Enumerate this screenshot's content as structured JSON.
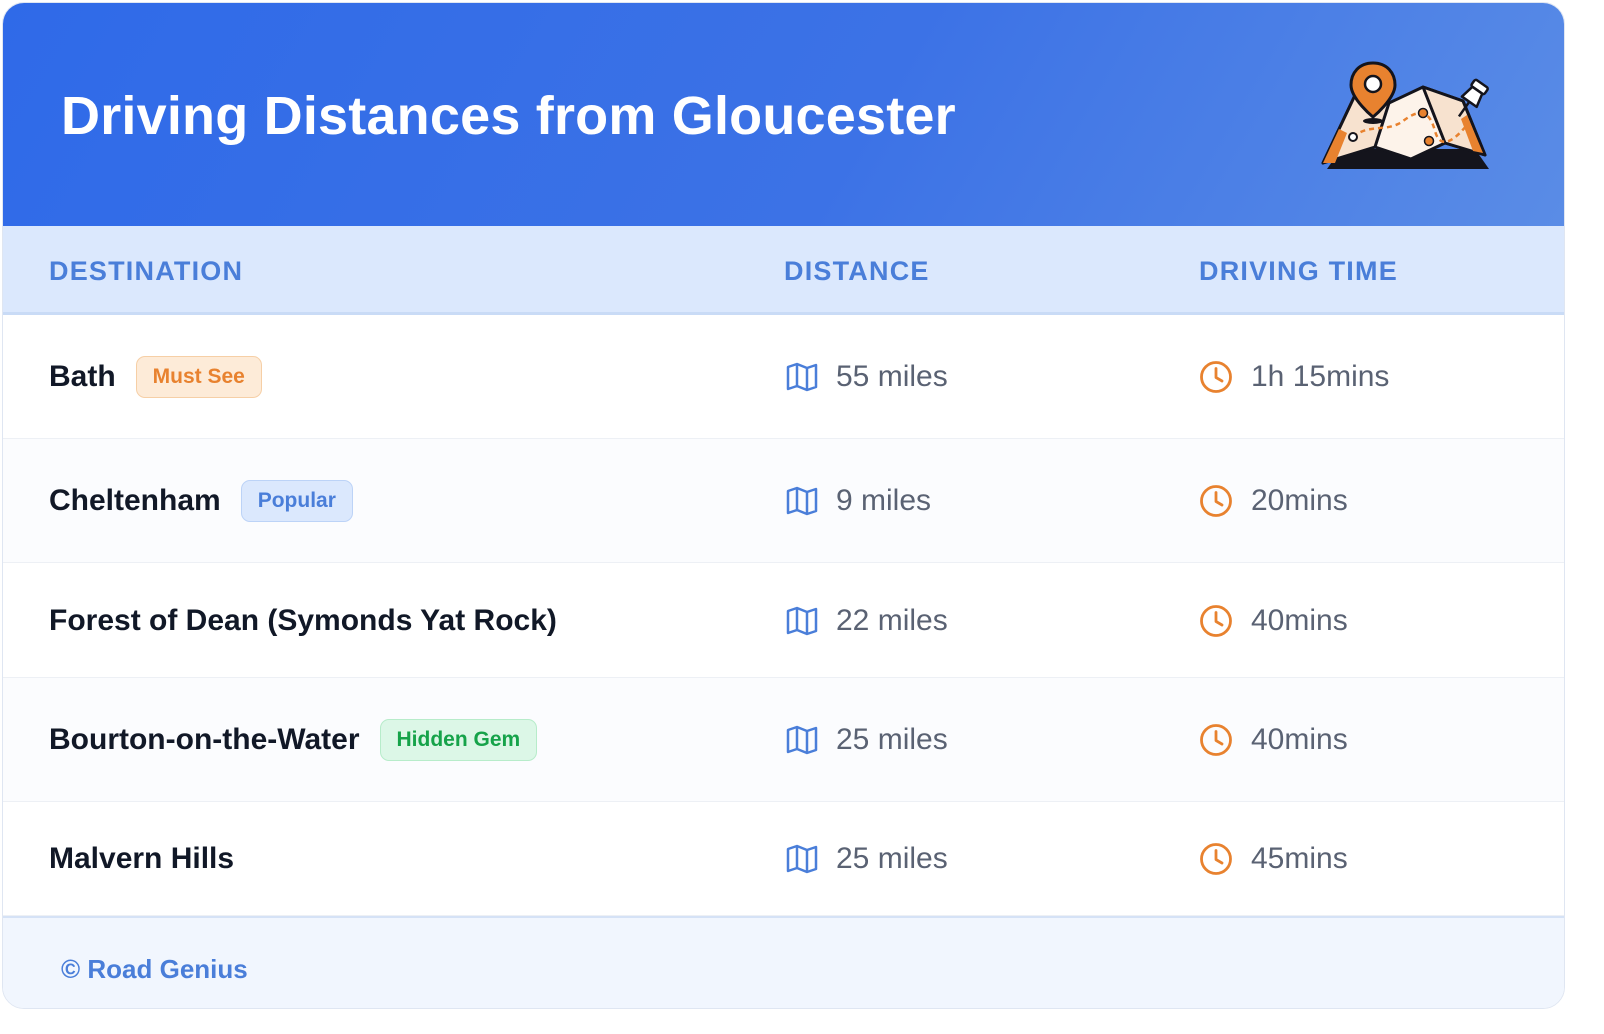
{
  "header": {
    "title": "Driving Distances from Gloucester",
    "illustration_icon": "map-with-pins-icon"
  },
  "columns": {
    "destination": "DESTINATION",
    "distance": "DISTANCE",
    "driving_time": "DRIVING TIME"
  },
  "rows": [
    {
      "destination": "Bath",
      "badge": "Must See",
      "badge_style": "orange",
      "distance": "55 miles",
      "time": "1h 15mins"
    },
    {
      "destination": "Cheltenham",
      "badge": "Popular",
      "badge_style": "blue",
      "distance": "9 miles",
      "time": "20mins"
    },
    {
      "destination": "Forest of Dean (Symonds Yat Rock)",
      "badge": "",
      "badge_style": "",
      "distance": "22 miles",
      "time": "40mins"
    },
    {
      "destination": "Bourton-on-the-Water",
      "badge": "Hidden Gem",
      "badge_style": "green",
      "distance": "25 miles",
      "time": "40mins"
    },
    {
      "destination": "Malvern Hills",
      "badge": "",
      "badge_style": "",
      "distance": "25 miles",
      "time": "45mins"
    }
  ],
  "icons": {
    "distance": "map-icon",
    "time": "clock-icon"
  },
  "footer": {
    "credit": "© Road Genius"
  },
  "colors": {
    "header_blue": "#2f6ae8",
    "accent_blue": "#4a7ed9",
    "orange": "#e8822f",
    "green": "#16a34a",
    "text_dark": "#111827",
    "text_muted": "#5a6273"
  }
}
